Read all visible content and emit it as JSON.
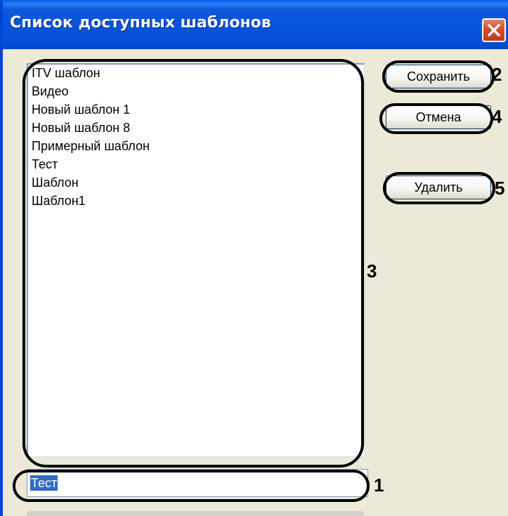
{
  "window": {
    "title": "Список доступных шаблонов",
    "close_icon": "close-icon"
  },
  "templates": {
    "items": [
      "ITV шаблон",
      "Видео",
      "Новый шаблон 1",
      "Новый шаблон 8",
      "Примерный шаблон",
      "Тест",
      "Шаблон",
      "Шаблон1"
    ]
  },
  "buttons": {
    "save": "Сохранить",
    "cancel": "Отмена",
    "delete": "Удалить"
  },
  "name_field": {
    "value": "Тест"
  },
  "callouts": {
    "name_field": "1",
    "save": "2",
    "list": "3",
    "cancel": "4",
    "delete": "5"
  },
  "colors": {
    "titlebar": "#0454dc",
    "selection": "#316ac5",
    "dialog_bg": "#ece9d8",
    "close_button": "#d8512d"
  }
}
